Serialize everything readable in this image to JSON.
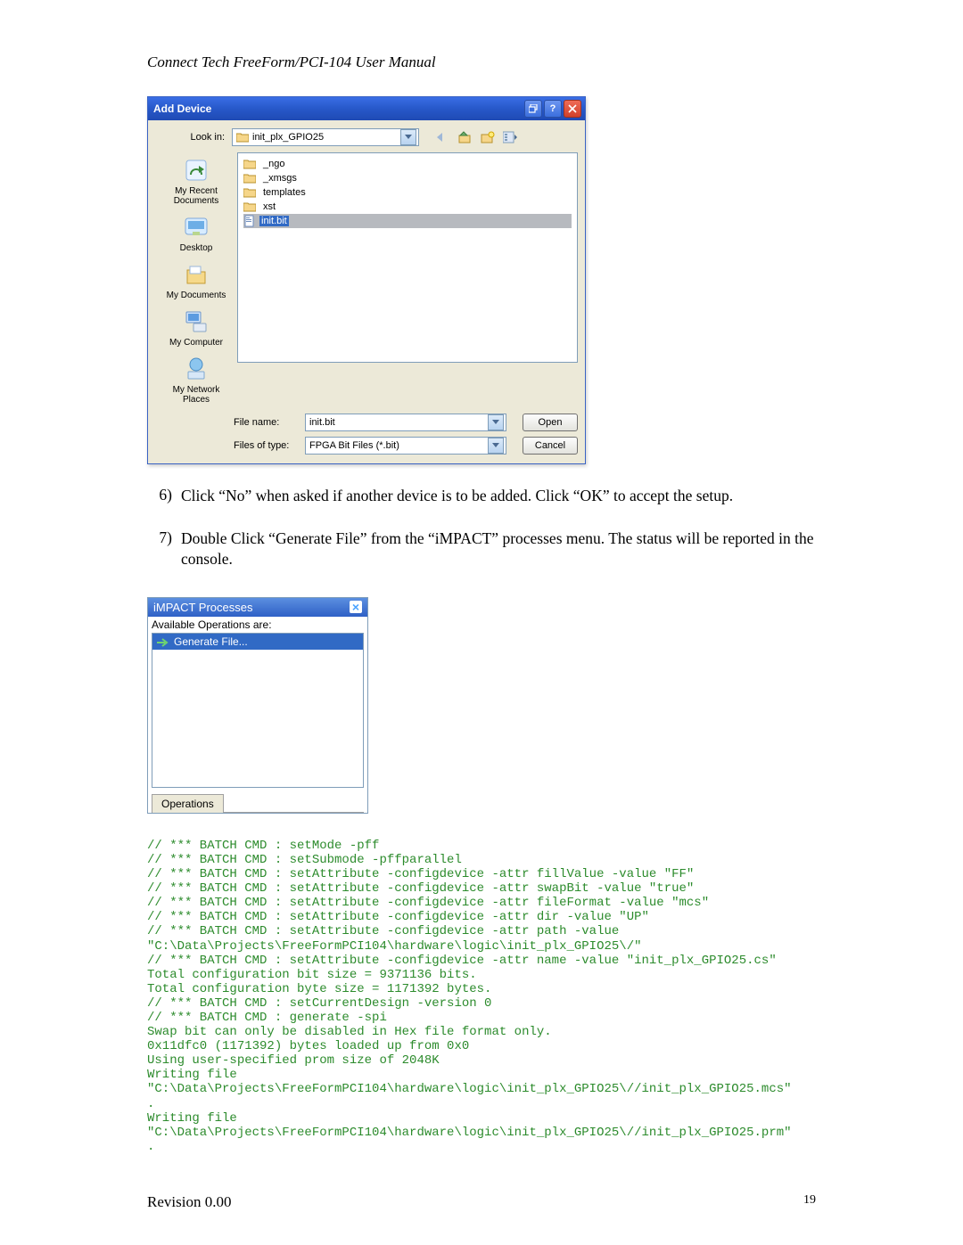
{
  "header": "Connect Tech FreeForm/PCI-104 User Manual",
  "dialog": {
    "title": "Add Device",
    "lookin_label": "Look in:",
    "lookin_value": "init_plx_GPIO25",
    "nav_icons": [
      "back-icon",
      "up-icon",
      "new-folder-icon",
      "views-icon"
    ],
    "places": [
      "My Recent Documents",
      "Desktop",
      "My Documents",
      "My Computer",
      "My Network Places"
    ],
    "files": [
      {
        "name": "_ngo",
        "type": "folder"
      },
      {
        "name": "_xmsgs",
        "type": "folder"
      },
      {
        "name": "templates",
        "type": "folder"
      },
      {
        "name": "xst",
        "type": "folder"
      },
      {
        "name": "init.bit",
        "type": "file",
        "selected": true
      }
    ],
    "filename_label": "File name:",
    "filename_value": "init.bit",
    "filetype_label": "Files of type:",
    "filetype_value": "FPGA Bit Files (*.bit)",
    "open_btn": "Open",
    "cancel_btn": "Cancel"
  },
  "steps": {
    "s6_num": "6)",
    "s6_text": "Click “No” when asked if another device is to be added.  Click “OK” to accept the setup.",
    "s7_num": "7)",
    "s7_text": "Double Click “Generate File” from the “iMPACT” processes menu.  The status will be reported in the console."
  },
  "impact": {
    "title": "iMPACT Processes",
    "avail": "Available Operations are:",
    "item": "Generate File...",
    "tab": "Operations"
  },
  "console_text": "// *** BATCH CMD : setMode -pff\n// *** BATCH CMD : setSubmode -pffparallel\n// *** BATCH CMD : setAttribute -configdevice -attr fillValue -value \"FF\"\n// *** BATCH CMD : setAttribute -configdevice -attr swapBit -value \"true\"\n// *** BATCH CMD : setAttribute -configdevice -attr fileFormat -value \"mcs\"\n// *** BATCH CMD : setAttribute -configdevice -attr dir -value \"UP\"\n// *** BATCH CMD : setAttribute -configdevice -attr path -value\n\"C:\\Data\\Projects\\FreeFormPCI104\\hardware\\logic\\init_plx_GPIO25\\/\"\n// *** BATCH CMD : setAttribute -configdevice -attr name -value \"init_plx_GPIO25.cs\"\nTotal configuration bit size = 9371136 bits.\nTotal configuration byte size = 1171392 bytes.\n// *** BATCH CMD : setCurrentDesign -version 0\n// *** BATCH CMD : generate -spi\nSwap bit can only be disabled in Hex file format only.\n0x11dfc0 (1171392) bytes loaded up from 0x0\nUsing user-specified prom size of 2048K\nWriting file\n\"C:\\Data\\Projects\\FreeFormPCI104\\hardware\\logic\\init_plx_GPIO25\\//init_plx_GPIO25.mcs\"\n.\nWriting file\n\"C:\\Data\\Projects\\FreeFormPCI104\\hardware\\logic\\init_plx_GPIO25\\//init_plx_GPIO25.prm\"\n.",
  "footer": {
    "revision": "Revision 0.00",
    "page": "19"
  }
}
